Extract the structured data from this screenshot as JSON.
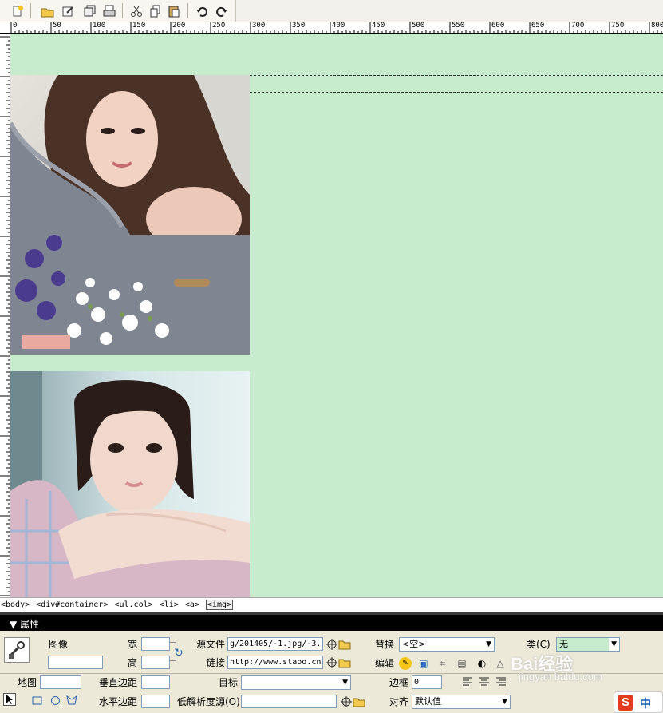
{
  "toolbar": {
    "icons": [
      "new-file-icon",
      "open-folder-icon",
      "edit-icon",
      "save-all-icon",
      "print-icon",
      "cut-icon",
      "copy-icon",
      "paste-icon",
      "undo-icon",
      "redo-icon"
    ]
  },
  "ruler": {
    "labels": [
      "0",
      "50",
      "100",
      "150",
      "200",
      "250",
      "300",
      "350",
      "400",
      "450",
      "500",
      "550",
      "600",
      "650",
      "700",
      "750",
      "800"
    ]
  },
  "tag_selector": {
    "tags": [
      "<body>",
      "<div#container>",
      "<ul.col>",
      "<li>",
      "<a>",
      "<img>"
    ]
  },
  "properties": {
    "header_title": "属性",
    "image_label": "图像",
    "image_name_value": "",
    "width_label": "宽",
    "width_value": "",
    "height_label": "高",
    "height_value": "",
    "src_label": "源文件",
    "src_value": "g/201405/-1.jpg/-3.j",
    "link_label": "链接",
    "link_value": "http://www.staoo.cn",
    "alt_label": "替换",
    "alt_value": "<空>",
    "class_label": "类(C)",
    "class_value": "无",
    "edit_label": "编辑",
    "map_label": "地图",
    "map_value": "",
    "vspace_label": "垂直边距",
    "vspace_value": "",
    "hspace_label": "水平边距",
    "hspace_value": "",
    "target_label": "目标",
    "target_value": "",
    "lowsrc_label": "低解析度源(O)",
    "lowsrc_value": "",
    "border_label": "边框",
    "border_value": "0",
    "align_label": "对齐",
    "align_value": "默认值"
  },
  "watermark": {
    "text": "Bai经验",
    "url": "jingyan.baidu.com"
  },
  "ime": {
    "label": "中"
  },
  "colors": {
    "canvas": "#c7ebcd",
    "panel": "#ece9d8"
  }
}
